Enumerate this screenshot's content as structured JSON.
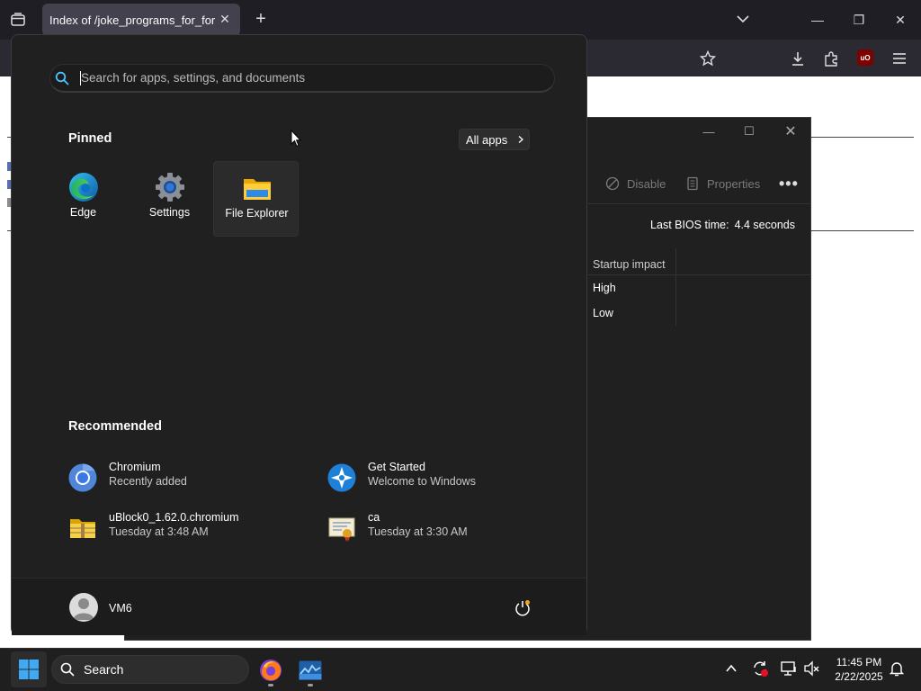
{
  "browser": {
    "tab_title": "Index of /joke_programs_for_forkies",
    "tab_close": "✕",
    "new_tab": "+",
    "window_buttons": [
      "—",
      "❐",
      "✕"
    ],
    "ublock_label": "uO"
  },
  "task_manager": {
    "toolbar": {
      "disable": "Disable",
      "properties": "Properties",
      "more": "•••"
    },
    "bios_label": "Last BIOS time:",
    "bios_value": "4.4 seconds",
    "column_header": "Startup impact",
    "impacts": [
      "High",
      "Low"
    ]
  },
  "start_menu": {
    "search_placeholder": "Search for apps, settings, and documents",
    "pinned_title": "Pinned",
    "all_apps_label": "All apps",
    "pinned": [
      {
        "label": "Edge",
        "icon": "edge-icon"
      },
      {
        "label": "Settings",
        "icon": "settings-gear-icon"
      },
      {
        "label": "File Explorer",
        "icon": "folder-icon"
      }
    ],
    "recommended_title": "Recommended",
    "recommended": [
      {
        "name": "Chromium",
        "sub": "Recently added",
        "icon": "chromium-icon"
      },
      {
        "name": "Get Started",
        "sub": "Welcome to Windows",
        "icon": "get-started-icon"
      },
      {
        "name": "uBlock0_1.62.0.chromium",
        "sub": "Tuesday at 3:48 AM",
        "icon": "zip-folder-icon"
      },
      {
        "name": "ca",
        "sub": "Tuesday at 3:30 AM",
        "icon": "certificate-icon"
      }
    ],
    "user_name": "VM6"
  },
  "taskbar": {
    "search_label": "Search",
    "time": "11:45 PM",
    "date": "2/22/2025"
  },
  "colors": {
    "start_bg": "#202020",
    "accent_blue": "#0078d4",
    "taskbar_bg": "#1f1f1f"
  }
}
